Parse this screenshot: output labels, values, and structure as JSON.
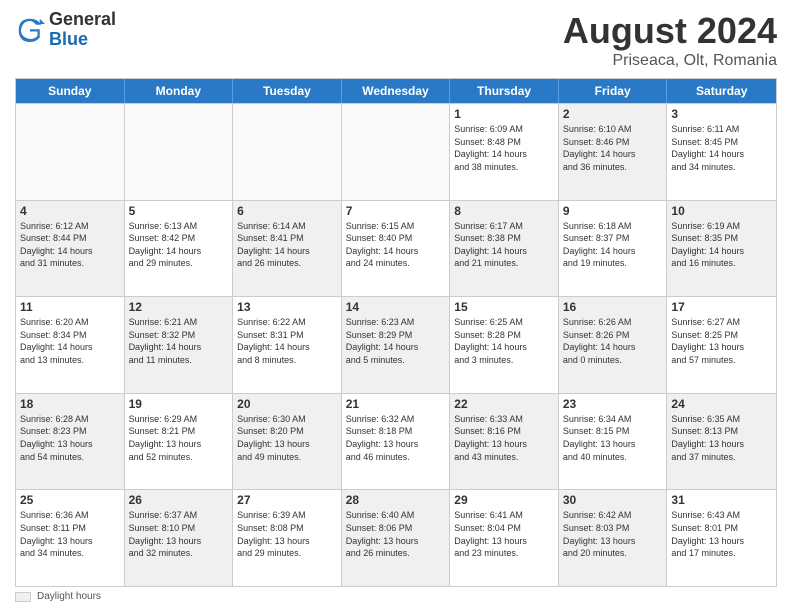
{
  "header": {
    "logo_general": "General",
    "logo_blue": "Blue",
    "title": "August 2024",
    "location": "Priseaca, Olt, Romania"
  },
  "days_of_week": [
    "Sunday",
    "Monday",
    "Tuesday",
    "Wednesday",
    "Thursday",
    "Friday",
    "Saturday"
  ],
  "legend": {
    "label": "Daylight hours"
  },
  "weeks": [
    [
      {
        "day": "",
        "info": "",
        "shaded": true
      },
      {
        "day": "",
        "info": "",
        "shaded": true
      },
      {
        "day": "",
        "info": "",
        "shaded": true
      },
      {
        "day": "",
        "info": "",
        "shaded": true
      },
      {
        "day": "1",
        "info": "Sunrise: 6:09 AM\nSunset: 8:48 PM\nDaylight: 14 hours\nand 38 minutes.",
        "shaded": false
      },
      {
        "day": "2",
        "info": "Sunrise: 6:10 AM\nSunset: 8:46 PM\nDaylight: 14 hours\nand 36 minutes.",
        "shaded": true
      },
      {
        "day": "3",
        "info": "Sunrise: 6:11 AM\nSunset: 8:45 PM\nDaylight: 14 hours\nand 34 minutes.",
        "shaded": false
      }
    ],
    [
      {
        "day": "4",
        "info": "Sunrise: 6:12 AM\nSunset: 8:44 PM\nDaylight: 14 hours\nand 31 minutes.",
        "shaded": true
      },
      {
        "day": "5",
        "info": "Sunrise: 6:13 AM\nSunset: 8:42 PM\nDaylight: 14 hours\nand 29 minutes.",
        "shaded": false
      },
      {
        "day": "6",
        "info": "Sunrise: 6:14 AM\nSunset: 8:41 PM\nDaylight: 14 hours\nand 26 minutes.",
        "shaded": true
      },
      {
        "day": "7",
        "info": "Sunrise: 6:15 AM\nSunset: 8:40 PM\nDaylight: 14 hours\nand 24 minutes.",
        "shaded": false
      },
      {
        "day": "8",
        "info": "Sunrise: 6:17 AM\nSunset: 8:38 PM\nDaylight: 14 hours\nand 21 minutes.",
        "shaded": true
      },
      {
        "day": "9",
        "info": "Sunrise: 6:18 AM\nSunset: 8:37 PM\nDaylight: 14 hours\nand 19 minutes.",
        "shaded": false
      },
      {
        "day": "10",
        "info": "Sunrise: 6:19 AM\nSunset: 8:35 PM\nDaylight: 14 hours\nand 16 minutes.",
        "shaded": true
      }
    ],
    [
      {
        "day": "11",
        "info": "Sunrise: 6:20 AM\nSunset: 8:34 PM\nDaylight: 14 hours\nand 13 minutes.",
        "shaded": false
      },
      {
        "day": "12",
        "info": "Sunrise: 6:21 AM\nSunset: 8:32 PM\nDaylight: 14 hours\nand 11 minutes.",
        "shaded": true
      },
      {
        "day": "13",
        "info": "Sunrise: 6:22 AM\nSunset: 8:31 PM\nDaylight: 14 hours\nand 8 minutes.",
        "shaded": false
      },
      {
        "day": "14",
        "info": "Sunrise: 6:23 AM\nSunset: 8:29 PM\nDaylight: 14 hours\nand 5 minutes.",
        "shaded": true
      },
      {
        "day": "15",
        "info": "Sunrise: 6:25 AM\nSunset: 8:28 PM\nDaylight: 14 hours\nand 3 minutes.",
        "shaded": false
      },
      {
        "day": "16",
        "info": "Sunrise: 6:26 AM\nSunset: 8:26 PM\nDaylight: 14 hours\nand 0 minutes.",
        "shaded": true
      },
      {
        "day": "17",
        "info": "Sunrise: 6:27 AM\nSunset: 8:25 PM\nDaylight: 13 hours\nand 57 minutes.",
        "shaded": false
      }
    ],
    [
      {
        "day": "18",
        "info": "Sunrise: 6:28 AM\nSunset: 8:23 PM\nDaylight: 13 hours\nand 54 minutes.",
        "shaded": true
      },
      {
        "day": "19",
        "info": "Sunrise: 6:29 AM\nSunset: 8:21 PM\nDaylight: 13 hours\nand 52 minutes.",
        "shaded": false
      },
      {
        "day": "20",
        "info": "Sunrise: 6:30 AM\nSunset: 8:20 PM\nDaylight: 13 hours\nand 49 minutes.",
        "shaded": true
      },
      {
        "day": "21",
        "info": "Sunrise: 6:32 AM\nSunset: 8:18 PM\nDaylight: 13 hours\nand 46 minutes.",
        "shaded": false
      },
      {
        "day": "22",
        "info": "Sunrise: 6:33 AM\nSunset: 8:16 PM\nDaylight: 13 hours\nand 43 minutes.",
        "shaded": true
      },
      {
        "day": "23",
        "info": "Sunrise: 6:34 AM\nSunset: 8:15 PM\nDaylight: 13 hours\nand 40 minutes.",
        "shaded": false
      },
      {
        "day": "24",
        "info": "Sunrise: 6:35 AM\nSunset: 8:13 PM\nDaylight: 13 hours\nand 37 minutes.",
        "shaded": true
      }
    ],
    [
      {
        "day": "25",
        "info": "Sunrise: 6:36 AM\nSunset: 8:11 PM\nDaylight: 13 hours\nand 34 minutes.",
        "shaded": false
      },
      {
        "day": "26",
        "info": "Sunrise: 6:37 AM\nSunset: 8:10 PM\nDaylight: 13 hours\nand 32 minutes.",
        "shaded": true
      },
      {
        "day": "27",
        "info": "Sunrise: 6:39 AM\nSunset: 8:08 PM\nDaylight: 13 hours\nand 29 minutes.",
        "shaded": false
      },
      {
        "day": "28",
        "info": "Sunrise: 6:40 AM\nSunset: 8:06 PM\nDaylight: 13 hours\nand 26 minutes.",
        "shaded": true
      },
      {
        "day": "29",
        "info": "Sunrise: 6:41 AM\nSunset: 8:04 PM\nDaylight: 13 hours\nand 23 minutes.",
        "shaded": false
      },
      {
        "day": "30",
        "info": "Sunrise: 6:42 AM\nSunset: 8:03 PM\nDaylight: 13 hours\nand 20 minutes.",
        "shaded": true
      },
      {
        "day": "31",
        "info": "Sunrise: 6:43 AM\nSunset: 8:01 PM\nDaylight: 13 hours\nand 17 minutes.",
        "shaded": false
      }
    ]
  ]
}
